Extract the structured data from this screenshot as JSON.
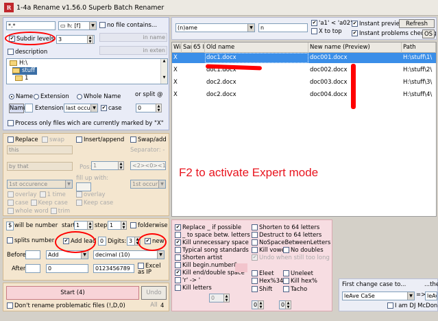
{
  "window": {
    "title": "1-4a Rename v1.56.0 Superb Batch Renamer",
    "logo": "R"
  },
  "left": {
    "mask_value": "*.*",
    "drive_label": "h: [f]",
    "no_file_contains": "no file contains...",
    "in_name": "in name",
    "in_exten": "in exten",
    "subdir_levels": "Subdir levels",
    "subdir_value": "3",
    "description": "description",
    "tree": [
      "H:\\",
      "stuff",
      "1"
    ],
    "radio_name": "Name",
    "radio_extension": "Extension",
    "radio_whole": "Whole Name",
    "or_split": "or split @",
    "name_btn": "Name",
    "extension_label": "Extension",
    "occurrence": "last occu",
    "case_label": "case",
    "split_value": "0",
    "process_marked": "Process only files wich are currently marked by \"X\""
  },
  "ops": {
    "replace": "Replace",
    "swap": "swap",
    "insert_append": "Insert/append",
    "swap_add": "Swap/add",
    "this_placeholder": "this",
    "by_placeholder": "by that",
    "separator": "Separator: -",
    "pos_label": "Pos:",
    "pos_value": "1",
    "fill_up": "fill up with:",
    "pattern": "<2><0><1>",
    "first_occ": "1st occurence",
    "first_occ2": "1st occur",
    "overlay": "overlay",
    "time": "1 time",
    "case": "case",
    "keep_case": "Keep case",
    "keep_case2": "Keep case",
    "whole_word": "whole word",
    "trim": "trim",
    "overlay2": "overlay"
  },
  "number": {
    "will_be_number_prefix": "$",
    "will_be_number": "will be number",
    "start_label": "start",
    "start_value": "1",
    "step_label": "step",
    "step_value": "1",
    "folderwise": "folderwise",
    "splits_number": "splits number",
    "add_leading": "Add lead",
    "leading_value": "0",
    "digits_label": "Digits:",
    "digits_value": "3",
    "new_label": "new",
    "before_label": "Before",
    "add_option": "Add",
    "decimal_option": "decimal (10)",
    "after_label": "After",
    "after_value": "0",
    "digits_set": "0123456789",
    "excel": "Excel as IP"
  },
  "bottom": {
    "start_btn": "Start (4)",
    "undo_btn": "Undo All",
    "dont_rename": "Don't rename problematic files (!,D,0)",
    "count": "4"
  },
  "top": {
    "name_pattern": "(n)ame",
    "n_value": "n",
    "sort_a1": "'a1' < 'a02'",
    "x_to_top": "X to top",
    "instant_preview": "Instant preview",
    "refresh": "Refresh",
    "instant_problems": "Instant problems checking",
    "os_btn": "OS"
  },
  "table": {
    "headers": [
      "Will",
      "Sar",
      "65 I",
      "Old name",
      "New name (Preview)",
      "Path"
    ],
    "rows": [
      {
        "mark": "X",
        "old": "doc1.docx",
        "new": "doc001.docx",
        "path": "H:\\stuff\\1\\"
      },
      {
        "mark": "X",
        "old": "doc1.docx",
        "new": "doc002.docx",
        "path": "H:\\stuff\\2\\"
      },
      {
        "mark": "X",
        "old": "doc2.docx",
        "new": "doc003.docx",
        "path": "H:\\stuff\\3\\"
      },
      {
        "mark": "X",
        "old": "doc2.docx",
        "new": "doc004.docx",
        "path": "H:\\stuff\\4\\"
      }
    ]
  },
  "hint": "F2 to activate Expert mode",
  "options": {
    "col1": [
      "Replace _ if possible",
      "_ to space betw. letters",
      "Kill unnecessary space",
      "Typical song standards",
      "Shorten artist",
      "Kill begin.number&..",
      "Kill end/double space",
      "'r' -> '",
      "Kill letters"
    ],
    "col1_checked": [
      true,
      false,
      true,
      false,
      false,
      false,
      true,
      false,
      false
    ],
    "kill_letters_value": "0",
    "col2": [
      "Shorten to 64 letters",
      "Destruct to 64 letters",
      "NoSpaceBetweenLetters",
      "Kill vowels",
      "No doubles",
      "Undo when still too long",
      "Eleet",
      "Uneleet",
      "Hex%34",
      "Kill hex%",
      "Shift",
      "Tacho"
    ],
    "spin_a": "0",
    "spin_b": "0"
  },
  "casepanel": {
    "first_change": "First change case to...",
    "then": "...then",
    "case_value": "leAve CaSe",
    "case_value2": "leAve",
    "dj": "I am DJ McDon"
  },
  "colors": {
    "accent": "#ff0000",
    "selected_row": "#3a8ee8",
    "hint": "#e8141e"
  }
}
